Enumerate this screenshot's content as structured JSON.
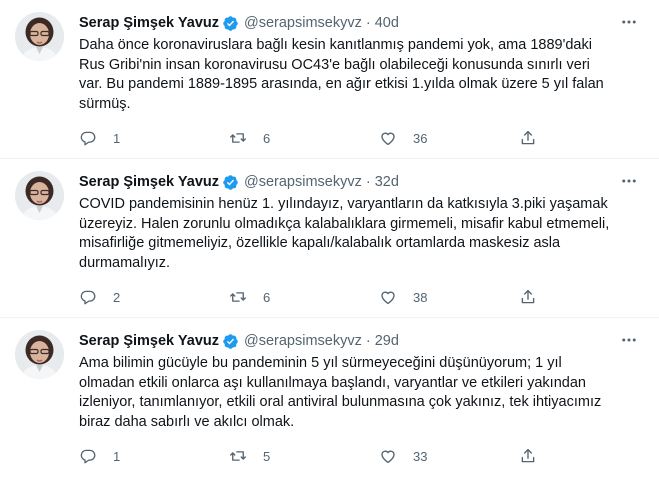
{
  "colors": {
    "text": "#0f1419",
    "secondary": "#536471",
    "verified": "#1d9bf0",
    "divider": "#eff3f4"
  },
  "icons": {
    "verified": "verified-badge-icon",
    "more": "more-options-icon",
    "reply": "reply-icon",
    "retweet": "retweet-icon",
    "like": "like-icon",
    "share": "share-icon"
  },
  "tweets": [
    {
      "author": "Serap Şimşek Yavuz",
      "handle": "@serapsimsekyvz",
      "separator": "·",
      "time": "40d",
      "lines": [
        "Daha önce koronaviruslara bağlı kesin kanıtlanmış pandemi yok, ama 1889'daki",
        "Rus Gribi'nin  insan koronavirusu OC43'e bağlı olabileceği konusunda sınırlı veri",
        "var. Bu pandemi 1889-1895 arasında, en ağır etkisi 1.yılda olmak üzere 5 yıl falan",
        "sürmüş."
      ],
      "replies": "1",
      "retweets": "6",
      "likes": "36"
    },
    {
      "author": "Serap Şimşek Yavuz",
      "handle": "@serapsimsekyvz",
      "separator": "·",
      "time": "32d",
      "lines": [
        "COVID pandemisinin henüz 1. yılındayız, varyantların da katkısıyla 3.piki yaşamak",
        "üzereyiz. Halen zorunlu olmadıkça kalabalıklara girmemeli, misafir kabul etmemeli,",
        "misafirliğe gitmemeliyiz, özellikle kapalı/kalabalık ortamlarda maskesiz asla",
        "durmamalıyız."
      ],
      "replies": "2",
      "retweets": "6",
      "likes": "38"
    },
    {
      "author": "Serap Şimşek Yavuz",
      "handle": "@serapsimsekyvz",
      "separator": "·",
      "time": "29d",
      "lines": [
        "Ama bilimin gücüyle bu pandeminin 5 yıl sürmeyeceğini düşünüyorum;  1 yıl",
        "olmadan etkili onlarca aşı kullanılmaya başlandı, varyantlar ve etkileri yakından",
        "izleniyor, tanımlanıyor, etkili oral antiviral bulunmasına çok yakınız, tek ihtiyacımız",
        "biraz daha sabırlı ve akılcı olmak."
      ],
      "replies": "1",
      "retweets": "5",
      "likes": "33"
    }
  ]
}
